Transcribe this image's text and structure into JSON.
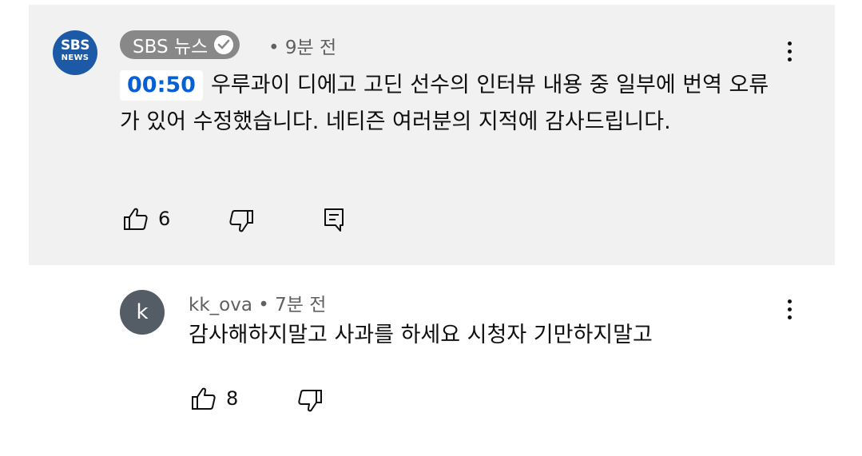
{
  "pinned_comment": {
    "avatar_line1": "SBS",
    "avatar_line2": "NEWS",
    "author": "SBS 뉴스",
    "time": "• 9분 전",
    "timestamp_link": "00:50",
    "text": "우루과이 디에고 고딘 선수의 인터뷰 내용 중 일부에 번역 오류가 있어 수정했습니다. 네티즌 여러분의 지적에 감사드립니다.",
    "like_count": "6"
  },
  "reply": {
    "avatar_letter": "k",
    "author": "kk_ova",
    "time": "• 7분 전",
    "text": "감사해하지말고 사과를 하세요 시청자 기만하지말고",
    "like_count": "8"
  },
  "icons": {
    "like": "thumb-up-icon",
    "dislike": "thumb-down-icon",
    "reply": "comment-reply-icon",
    "more": "more-vert-icon",
    "verified": "verified-check-icon"
  },
  "colors": {
    "pinned_bg": "#f1f1f1",
    "timestamp_link": "#065fd4",
    "sbs_avatar": "#1c5aa8",
    "chip_bg": "#888888",
    "reply_avatar": "#545c66"
  }
}
